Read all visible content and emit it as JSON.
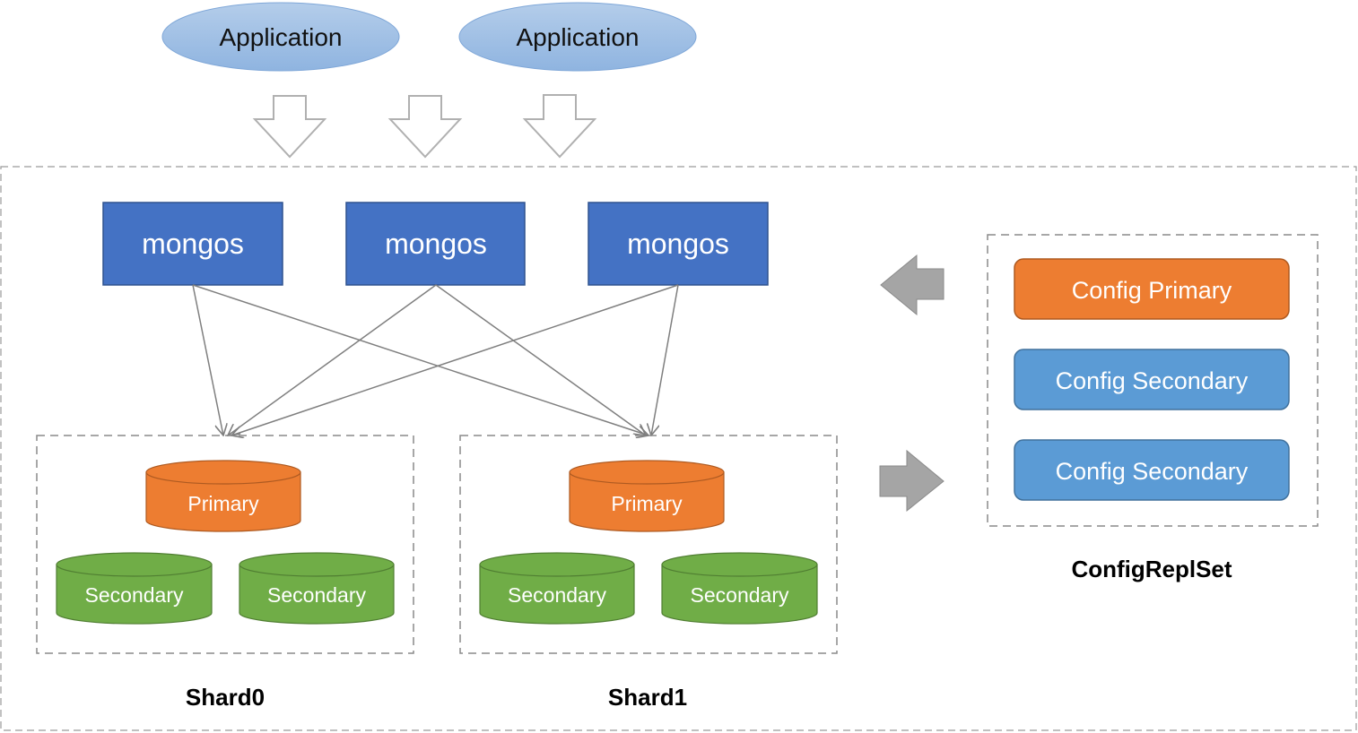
{
  "applications": [
    {
      "label": "Application"
    },
    {
      "label": "Application"
    }
  ],
  "mongos": [
    {
      "label": "mongos"
    },
    {
      "label": "mongos"
    },
    {
      "label": "mongos"
    }
  ],
  "shards": [
    {
      "name": "Shard0",
      "primary": "Primary",
      "secondaries": [
        "Secondary",
        "Secondary"
      ]
    },
    {
      "name": "Shard1",
      "primary": "Primary",
      "secondaries": [
        "Secondary",
        "Secondary"
      ]
    }
  ],
  "config_replset": {
    "name": "ConfigReplSet",
    "members": [
      {
        "label": "Config Primary",
        "role": "primary"
      },
      {
        "label": "Config Secondary",
        "role": "secondary"
      },
      {
        "label": "Config Secondary",
        "role": "secondary"
      }
    ]
  },
  "colors": {
    "application_fill": "#9DC3E6",
    "mongos_fill": "#4472C4",
    "primary_fill": "#ED7D31",
    "secondary_fill": "#70AD47",
    "config_secondary_fill": "#5B9BD5",
    "connector": "#7F7F7F",
    "dashed_border": "#808080"
  }
}
